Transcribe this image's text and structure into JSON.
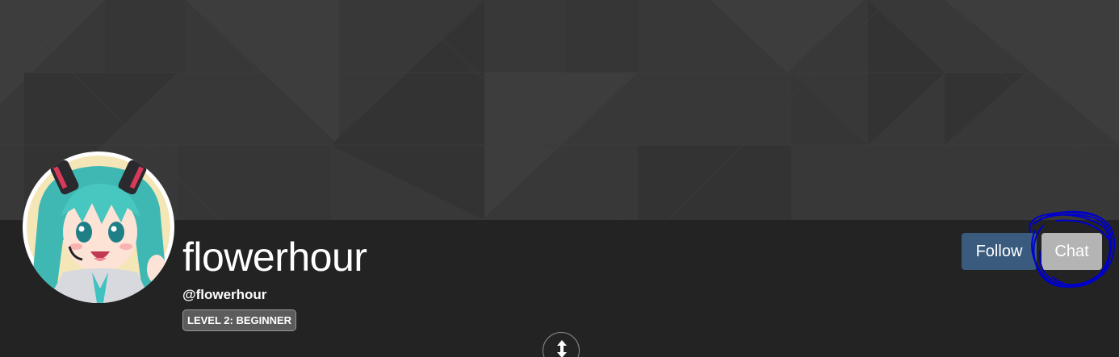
{
  "profile": {
    "display_name": "flowerhour",
    "handle": "@flowerhour",
    "level_badge": "LEVEL 2: BEGINNER",
    "avatar_icon": "anime-girl-avatar"
  },
  "actions": {
    "follow_label": "Follow",
    "chat_label": "Chat"
  },
  "toggle": {
    "icon": "expand-vertical-arrows-icon"
  },
  "colors": {
    "banner": "#383838",
    "info_bar": "#232323",
    "follow_button": "#3a5b7e",
    "chat_button": "#b4b4b4",
    "scribble": "#0000cc"
  }
}
